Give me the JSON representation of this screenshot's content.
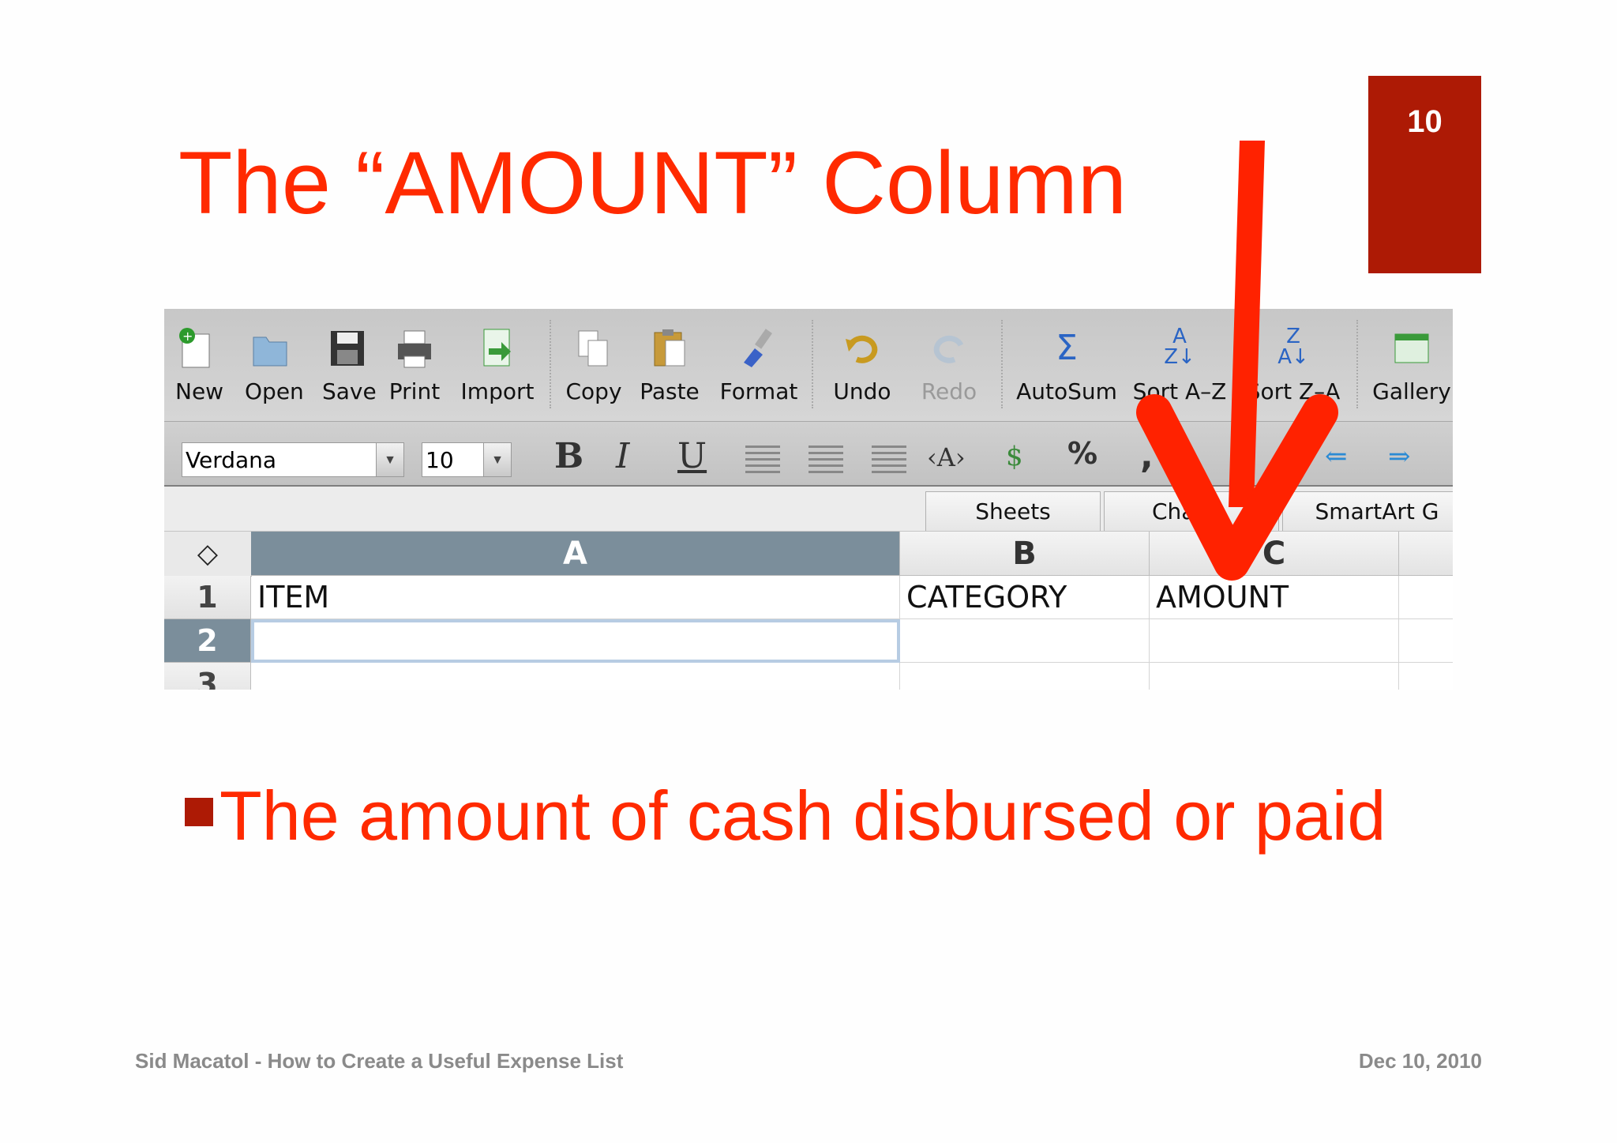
{
  "slide": {
    "number": "10",
    "title": "The “AMOUNT” Column",
    "bullet": "The amount of cash disbursed or paid",
    "footer_left": "Sid Macatol - How to Create a Useful Expense List",
    "footer_right": "Dec 10, 2010",
    "accent_color": "#ff2a00",
    "box_color": "#ad1a05"
  },
  "toolbar": {
    "buttons": [
      {
        "label": "New",
        "icon": "new-document-icon",
        "disabled": false
      },
      {
        "label": "Open",
        "icon": "open-folder-icon",
        "disabled": false
      },
      {
        "label": "Save",
        "icon": "floppy-disk-icon",
        "disabled": false
      },
      {
        "label": "Print",
        "icon": "printer-icon",
        "disabled": false
      },
      {
        "label": "Import",
        "icon": "import-icon",
        "disabled": false
      },
      {
        "label": "Copy",
        "icon": "copy-icon",
        "disabled": false
      },
      {
        "label": "Paste",
        "icon": "clipboard-icon",
        "disabled": false
      },
      {
        "label": "Format",
        "icon": "paintbrush-icon",
        "disabled": false
      },
      {
        "label": "Undo",
        "icon": "undo-icon",
        "disabled": false
      },
      {
        "label": "Redo",
        "icon": "redo-icon",
        "disabled": true
      },
      {
        "label": "AutoSum",
        "icon": "sigma-icon",
        "disabled": false
      },
      {
        "label": "Sort A–Z",
        "icon": "sort-ascending-icon",
        "disabled": false
      },
      {
        "label": "Sort Z–A",
        "icon": "sort-descending-icon",
        "disabled": false
      },
      {
        "label": "Gallery",
        "icon": "gallery-icon",
        "disabled": false
      }
    ]
  },
  "format_bar": {
    "font": "Verdana",
    "size": "10",
    "bold": "B",
    "italic": "I",
    "underline": "U",
    "percent": "%",
    "comma": ","
  },
  "ribbon": {
    "tabs": [
      "Sheets",
      "Cha",
      "SmartArt G"
    ]
  },
  "sheet": {
    "columns": [
      "A",
      "B",
      "C"
    ],
    "rows": [
      "1",
      "2",
      "3"
    ],
    "row1": [
      "ITEM",
      "CATEGORY",
      "AMOUNT"
    ]
  }
}
